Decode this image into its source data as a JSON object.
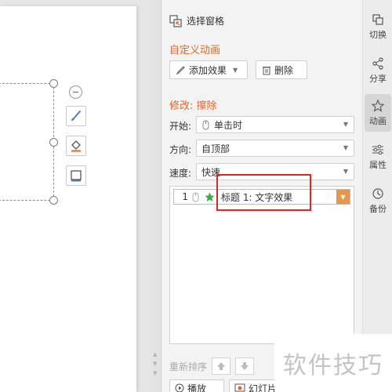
{
  "pane": {
    "header": "选择窗格",
    "custom_animation": "自定义动画",
    "add_effect": "添加效果",
    "delete": "删除",
    "modify_title": "修改: 擦除",
    "start_label": "开始:",
    "start_value": "单击时",
    "direction_label": "方向:",
    "direction_value": "自顶部",
    "speed_label": "速度:",
    "speed_value": "快速",
    "list": [
      {
        "index": "1",
        "text": "标题 1: 文字效果"
      }
    ],
    "reorder_label": "重新排序",
    "play": "播放",
    "slideshow": "幻灯片"
  },
  "right_bar": {
    "items": [
      {
        "label": "切换",
        "icon": "switch-icon"
      },
      {
        "label": "分享",
        "icon": "share-icon"
      },
      {
        "label": "动画",
        "icon": "star-icon",
        "active": true
      },
      {
        "label": "属性",
        "icon": "sliders-icon"
      },
      {
        "label": "备份",
        "icon": "history-icon"
      }
    ]
  },
  "colors": {
    "accent": "#e2662a",
    "highlight_box": "#d42a2a",
    "dropdown_accent": "#e8964a"
  },
  "watermark": "软件技巧"
}
